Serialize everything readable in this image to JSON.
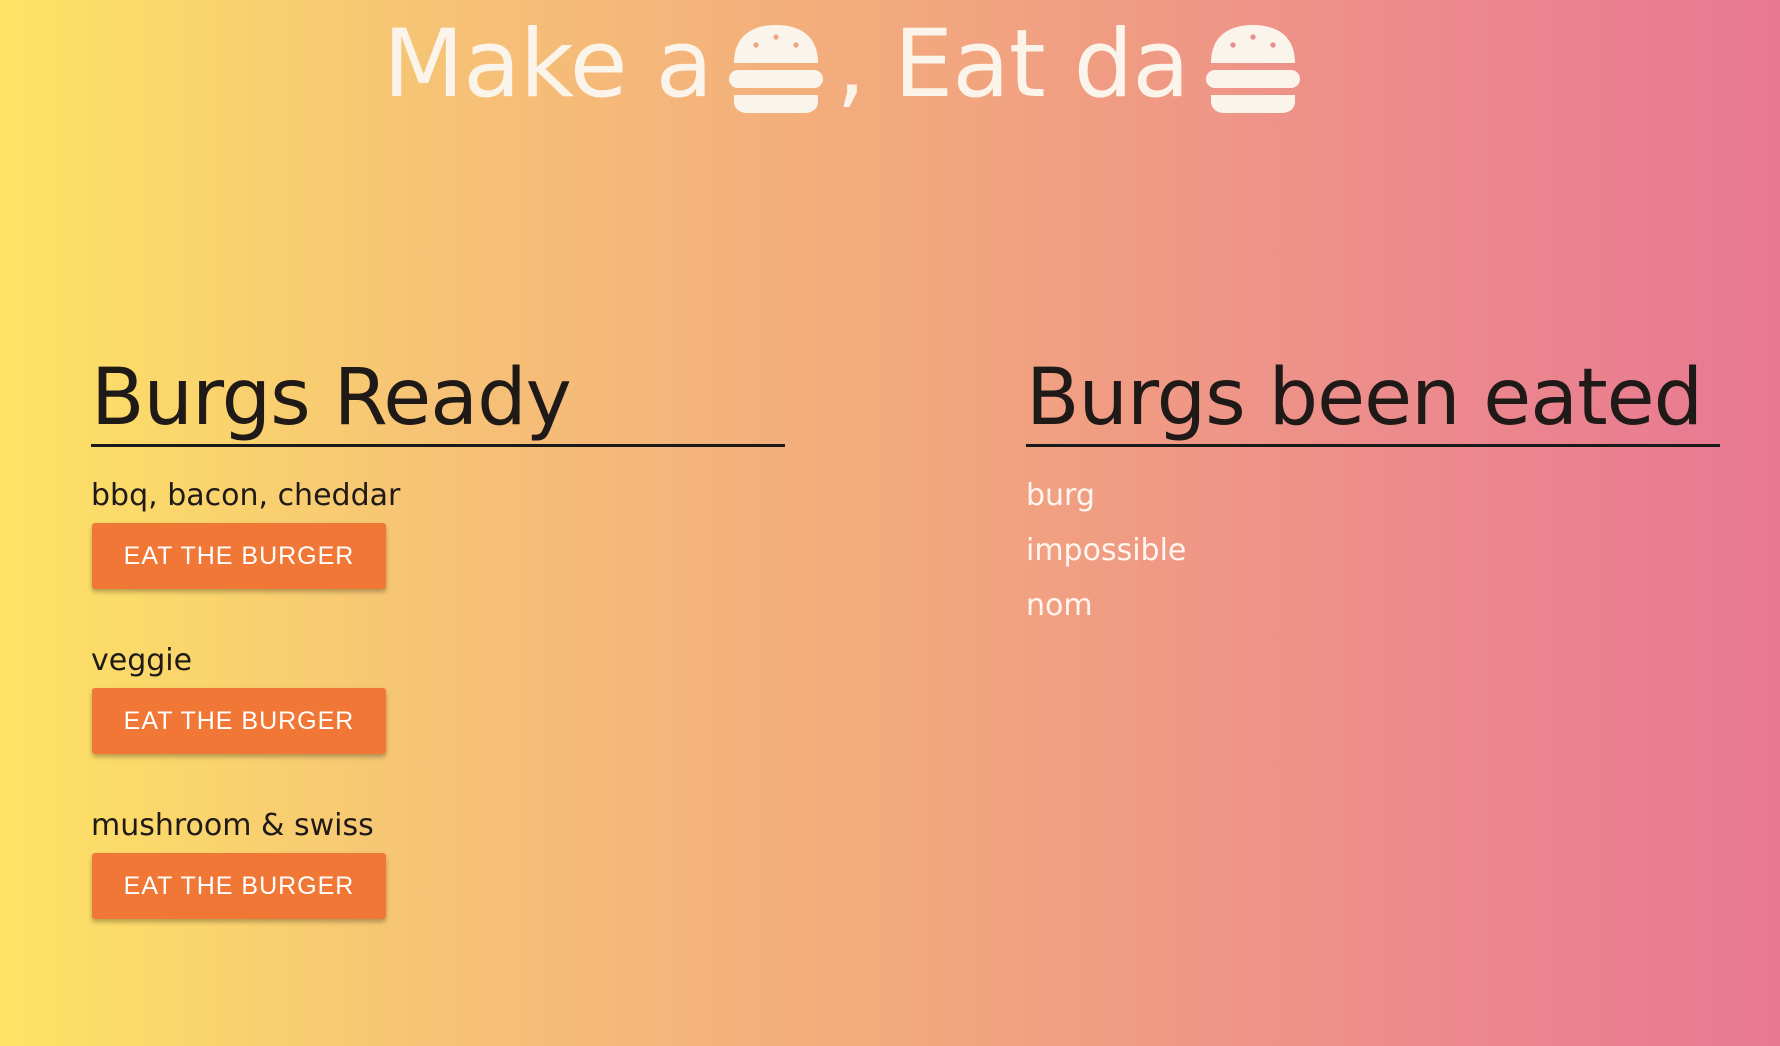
{
  "header": {
    "title_part1": "Make a",
    "title_part2": ", Eat da",
    "icon": "burger-icon",
    "text_color": "#fbf4ea"
  },
  "ready": {
    "title": "Burgs Ready",
    "items": [
      {
        "name": "bbq, bacon, cheddar",
        "button_label": "EAT THE BURGER"
      },
      {
        "name": "veggie",
        "button_label": "EAT THE BURGER"
      },
      {
        "name": "mushroom & swiss",
        "button_label": "EAT THE BURGER"
      }
    ]
  },
  "eaten": {
    "title": "Burgs been eated",
    "items": [
      "burg",
      "impossible",
      "nom"
    ]
  },
  "colors": {
    "button": "#f07735",
    "gradient_left": "#fde365",
    "gradient_right": "#e87891"
  }
}
